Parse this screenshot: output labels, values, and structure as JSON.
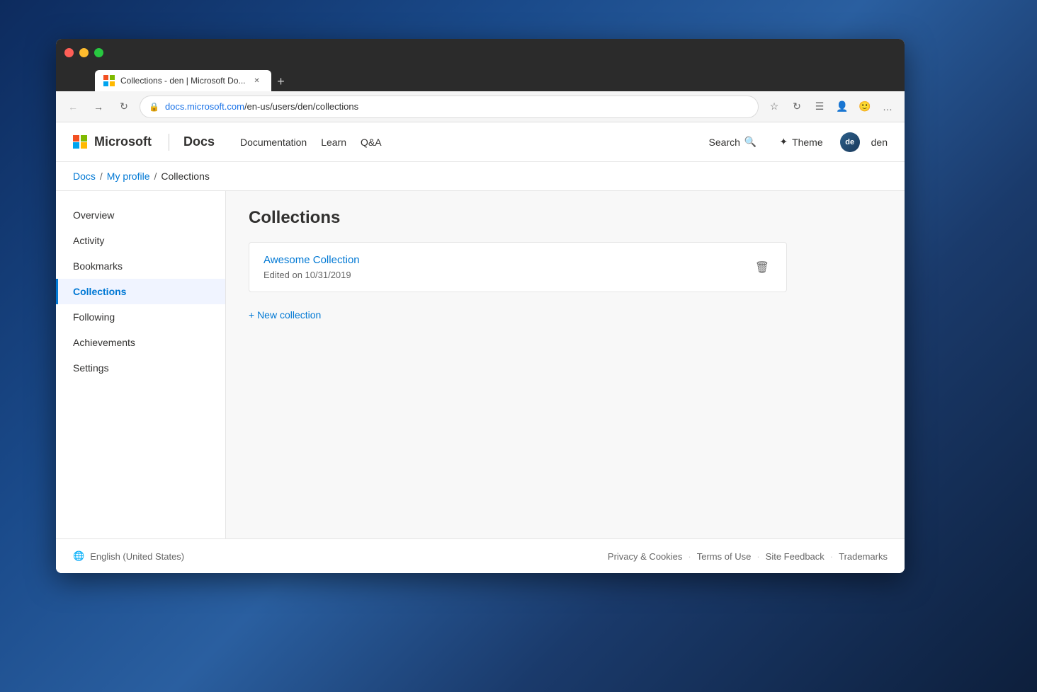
{
  "browser": {
    "tab_title": "Collections - den | Microsoft Do...",
    "tab_favicon": "M",
    "url": "https://docs.microsoft.com/en-us/users/den/collections",
    "url_domain": "docs.microsoft.com",
    "url_path": "/en-us/users/den/collections"
  },
  "site": {
    "microsoft_label": "Microsoft",
    "docs_label": "Docs",
    "nav": {
      "documentation": "Documentation",
      "learn": "Learn",
      "qa": "Q&A"
    },
    "search_label": "Search",
    "theme_label": "Theme",
    "user_name": "den",
    "user_initials": "de"
  },
  "breadcrumb": {
    "docs": "Docs",
    "my_profile": "My profile",
    "collections": "Collections"
  },
  "sidebar": {
    "items": [
      {
        "id": "overview",
        "label": "Overview",
        "active": false
      },
      {
        "id": "activity",
        "label": "Activity",
        "active": false
      },
      {
        "id": "bookmarks",
        "label": "Bookmarks",
        "active": false
      },
      {
        "id": "collections",
        "label": "Collections",
        "active": true
      },
      {
        "id": "following",
        "label": "Following",
        "active": false
      },
      {
        "id": "achievements",
        "label": "Achievements",
        "active": false
      },
      {
        "id": "settings",
        "label": "Settings",
        "active": false
      }
    ]
  },
  "main": {
    "page_title": "Collections",
    "collection": {
      "name": "Awesome Collection",
      "edited": "Edited on 10/31/2019"
    },
    "new_collection_label": "+ New collection"
  },
  "footer": {
    "locale": "English (United States)",
    "links": [
      "Privacy & Cookies",
      "Terms of Use",
      "Site Feedback",
      "Trademarks"
    ]
  }
}
